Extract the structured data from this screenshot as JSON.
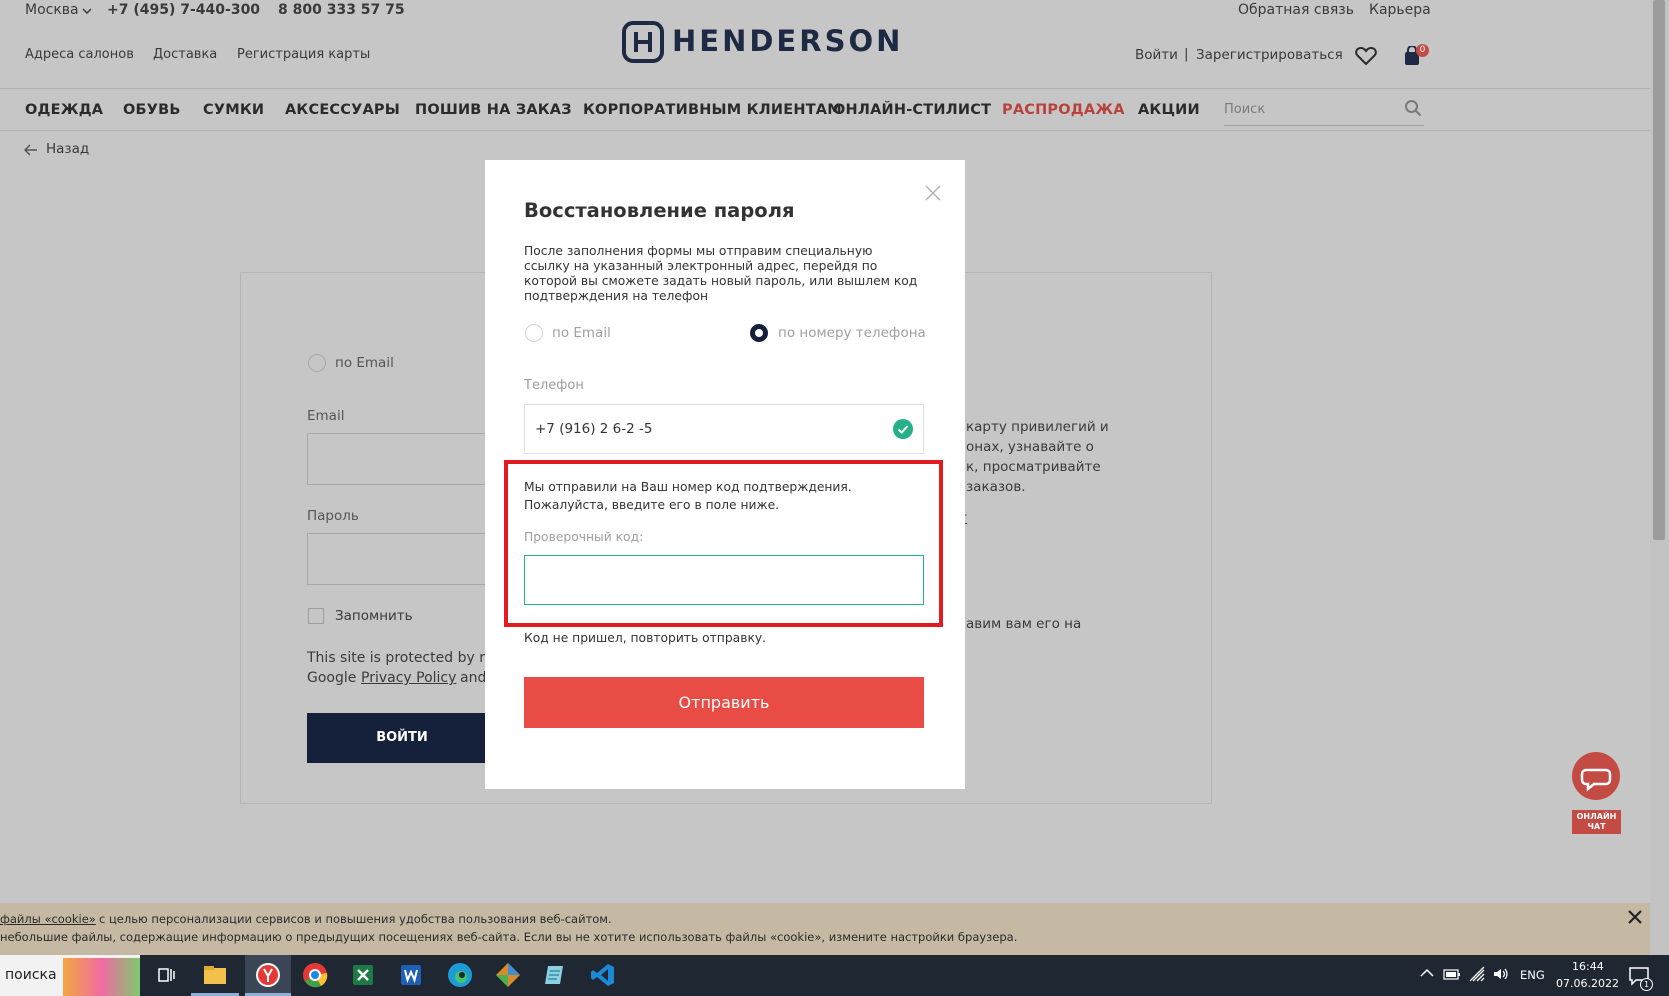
{
  "header": {
    "city": "Москва",
    "phone1": "+7 (495) 7-440-300",
    "phone2": "8 800 333 57 75",
    "feedback": "Обратная связь",
    "career": "Карьера",
    "links": [
      "Адреса салонов",
      "Доставка",
      "Регистрация карты"
    ],
    "logo_text": "HENDERSON",
    "login": "Войти",
    "divider": "|",
    "register": "Зарегистрироваться",
    "cart_count": "0"
  },
  "nav": {
    "items": [
      "ОДЕЖДА",
      "ОБУВЬ",
      "СУМКИ",
      "АКСЕССУАРЫ",
      "ПОШИВ НА ЗАКАЗ",
      "КОРПОРАТИВНЫМ КЛИЕНТАМ",
      "ОНЛАЙН-СТИЛИСТ",
      "РАСПРОДАЖА",
      "АКЦИИ"
    ],
    "search_placeholder": "Поиск"
  },
  "back": "Назад",
  "background_form": {
    "radio_email": "по Email",
    "email_label": "Email",
    "password_label": "Пароль",
    "remember": "Запомнить",
    "recaptcha_line1": "This site is protected by re",
    "recaptcha_line2_pre": "Google",
    "privacy_link": "Privacy Policy",
    "recaptcha_line2_post": "and",
    "login_button": "ВОЙТИ",
    "right_text": [
      "карту привилегий и",
      "онах, узнавайте о",
      "к, просматривайте",
      "заказов."
    ],
    "right_link": "г",
    "right_text2": "авим вам его на"
  },
  "modal": {
    "title": "Восстановление пароля",
    "description": [
      "После заполнения формы мы отправим специальную",
      "ссылку на указанный электронный адрес, перейдя по",
      "которой вы сможете задать новый пароль, или вышлем код",
      "подтверждения на телефон"
    ],
    "radio_email": "по Email",
    "radio_phone": "по номеру телефона",
    "phone_label": "Телефон",
    "phone_value": "+7 (916) 2  6-2  -5",
    "sent_message": [
      "Мы отправили на Ваш номер код подтверждения.",
      "Пожалуйста, введите его в поле ниже."
    ],
    "code_label": "Проверочный код:",
    "code_value": "",
    "resend": "Код не пришел, повторить отправку.",
    "submit": "Отправить"
  },
  "chat": {
    "line1": "ОНЛАЙН",
    "line2": "ЧАТ"
  },
  "cookie": {
    "line1_link": "файлы «cookie»",
    "line1_rest": " с целью персонализации сервисов и повышения удобства пользования веб-сайтом.",
    "line2": "небольшие файлы, содержащие информацию о предыдущих посещениях веб-сайта. Если вы не хотите использовать файлы «cookie», измените настройки браузера."
  },
  "taskbar": {
    "search_text": "поиска",
    "lang": "ENG",
    "time": "16:44",
    "date": "07.06.2022",
    "notifications": "1"
  },
  "colors": {
    "accent": "#e84c44",
    "navy": "#15203a",
    "highlight": "#e11b22",
    "success": "#26b08a"
  }
}
